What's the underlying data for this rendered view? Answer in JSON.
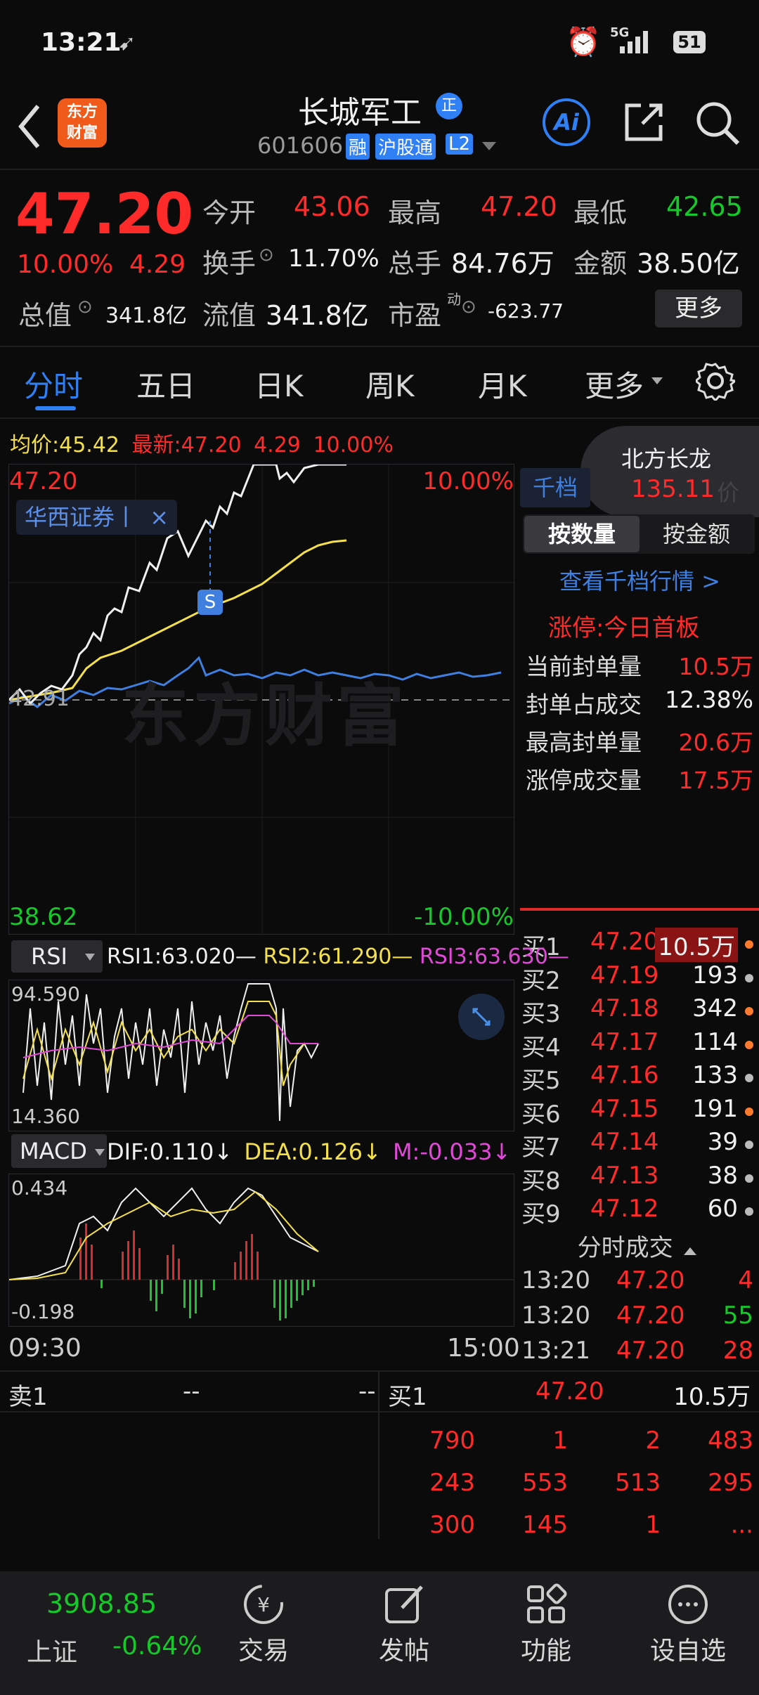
{
  "status_bar": {
    "time": "13:21",
    "network": "5G",
    "battery": "51"
  },
  "header": {
    "back_label": "‹",
    "logo_line1": "东方",
    "logo_line2": "财富",
    "stock_name": "长城军工",
    "badge_zheng": "正",
    "stock_code": "601606",
    "tag_rong": "融",
    "tag_hugutong": "沪股通",
    "tag_l2": "L2",
    "ai_label": "Ai"
  },
  "quote": {
    "price": "47.20",
    "change_pct": "10.00%",
    "change_amt": "4.29",
    "open_label": "今开",
    "open_value": "43.06",
    "high_label": "最高",
    "high_value": "47.20",
    "low_label": "最低",
    "low_value": "42.65",
    "turnover_label": "换手",
    "turnover_value": "11.70%",
    "volume_label": "总手",
    "volume_value": "84.76万",
    "amount_label": "金额",
    "amount_value": "38.50亿",
    "mktcap_label": "总值",
    "mktcap_value": "341.8亿",
    "float_label": "流值",
    "float_value": "341.8亿",
    "pe_label": "市盈",
    "pe_superscript": "动",
    "pe_value": "-623.77",
    "more_button": "更多"
  },
  "tabs": [
    "分时",
    "五日",
    "日K",
    "周K",
    "月K",
    "更多"
  ],
  "chart_info": {
    "avg_label": "均价:",
    "avg_value": "45.42",
    "latest_label": "最新:",
    "latest_value": "47.20",
    "latest_change": "4.29",
    "latest_pct": "10.00%",
    "top_price": "47.20",
    "top_pct": "10.00%",
    "bottom_price": "38.62",
    "bottom_pct": "-10.00%",
    "prev_close": "42.91",
    "broker_tag": "华西证券丨",
    "close_tag": "×",
    "marker_s": "S",
    "watermark": "东方财富",
    "time_start": "09:30",
    "time_end": "15:00"
  },
  "floating_bubble": {
    "title": "北方长龙",
    "value": "135.11"
  },
  "right_panel": {
    "tab_qiandang": "千档",
    "partial_text": "价",
    "btn_by_qty": "按数量",
    "btn_by_amount": "按金额",
    "view_link": "查看千档行情 >",
    "limit_title": "涨停:今日首板",
    "stats": [
      {
        "label": "当前封单量",
        "value": "10.5万",
        "color": "red"
      },
      {
        "label": "封单占成交",
        "value": "12.38%",
        "color": "white"
      },
      {
        "label": "最高封单量",
        "value": "20.6万",
        "color": "red"
      },
      {
        "label": "涨停成交量",
        "value": "17.5万",
        "color": "red"
      }
    ],
    "bids": [
      {
        "label": "买1",
        "price": "47.20",
        "qty": "10.5万",
        "dot": "orange"
      },
      {
        "label": "买2",
        "price": "47.19",
        "qty": "193",
        "dot": "grey"
      },
      {
        "label": "买3",
        "price": "47.18",
        "qty": "342",
        "dot": "orange"
      },
      {
        "label": "买4",
        "price": "47.17",
        "qty": "114",
        "dot": "orange"
      },
      {
        "label": "买5",
        "price": "47.16",
        "qty": "133",
        "dot": "grey"
      },
      {
        "label": "买6",
        "price": "47.15",
        "qty": "191",
        "dot": "orange"
      },
      {
        "label": "买7",
        "price": "47.14",
        "qty": "39",
        "dot": "grey"
      },
      {
        "label": "买8",
        "price": "47.13",
        "qty": "38",
        "dot": "grey"
      },
      {
        "label": "买9",
        "price": "47.12",
        "qty": "60",
        "dot": "grey"
      }
    ],
    "trades_title": "分时成交",
    "trades": [
      {
        "time": "13:20",
        "price": "47.20",
        "vol": "4",
        "vol_color": "red"
      },
      {
        "time": "13:20",
        "price": "47.20",
        "vol": "55",
        "vol_color": "green"
      },
      {
        "time": "13:21",
        "price": "47.20",
        "vol": "28",
        "vol_color": "red"
      }
    ]
  },
  "rsi": {
    "label": "RSI",
    "rsi1": "RSI1:63.020",
    "rsi2": "RSI2:61.290",
    "rsi3": "RSI3:63.630",
    "top": "94.590",
    "bottom": "14.360"
  },
  "macd": {
    "label": "MACD",
    "dif": "DIF:0.110",
    "dea": "DEA:0.126",
    "m": "M:-0.033",
    "top": "0.434",
    "bottom": "-0.198"
  },
  "order_queue": {
    "sell_label": "卖1",
    "sell_price": "--",
    "sell_qty": "--",
    "buy_label": "买1",
    "buy_price": "47.20",
    "buy_qty": "10.5万",
    "rows": [
      [
        "790",
        "1",
        "2",
        "483"
      ],
      [
        "243",
        "553",
        "513",
        "295"
      ],
      [
        "300",
        "145",
        "1",
        "..."
      ]
    ]
  },
  "bottom_nav": {
    "index_value": "3908.85",
    "index_name": "上证",
    "index_change": "-0.64%",
    "items": [
      "交易",
      "发帖",
      "功能",
      "设自选"
    ]
  }
}
